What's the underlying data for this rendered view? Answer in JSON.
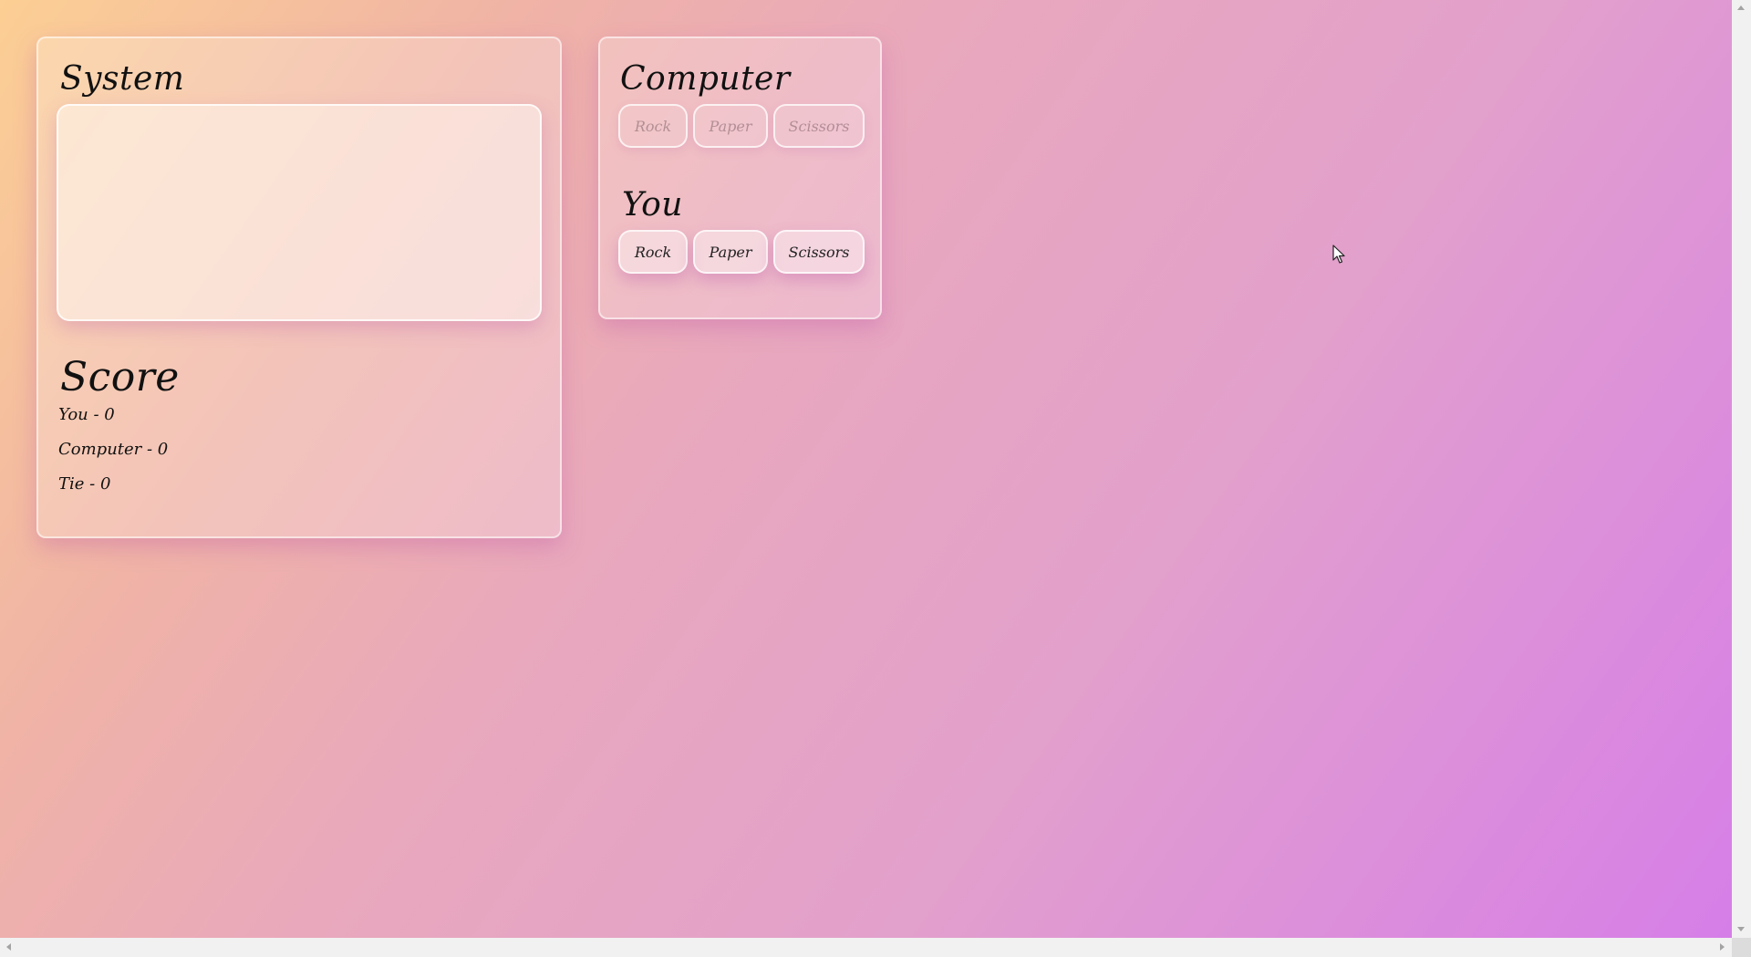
{
  "system": {
    "title": "System",
    "log": ""
  },
  "score": {
    "title": "Score",
    "you": "You - 0",
    "computer": "Computer - 0",
    "tie": "Tie - 0"
  },
  "computer": {
    "title": "Computer",
    "buttons": [
      "Rock",
      "Paper",
      "Scissors"
    ]
  },
  "you": {
    "title": "You",
    "buttons": [
      "Rock",
      "Paper",
      "Scissors"
    ]
  },
  "icons": {
    "cursor": "mouse-pointer-icon"
  },
  "colors": {
    "gradient_start": "#fccf94",
    "gradient_end": "#d67ee8",
    "text": "#111111"
  }
}
